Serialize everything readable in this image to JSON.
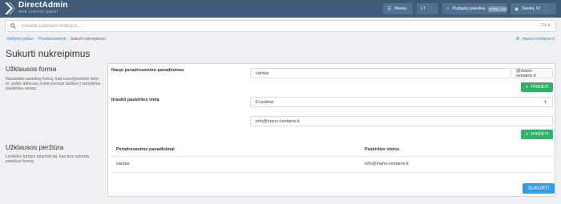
{
  "brand": {
    "title": "DirectAdmin",
    "subtitle": "web control panel"
  },
  "topbar": {
    "menu_label": "Meniu",
    "lang_label": "LT",
    "search_label": "Pudapių paieška",
    "search_kbd": "CTRL + K",
    "user_label": "Sveiki, iV"
  },
  "search": {
    "placeholder": "Įveskite paieškos kriterijus...",
    "shortcut": "Ctrl K"
  },
  "breadcrumb": {
    "items": [
      "Valdymo pultas",
      "Peradresavimai",
      "Sukurti nukreipimus"
    ]
  },
  "domain": "mano-svetaine.lt",
  "page_title": "Sukurti nukreipimus",
  "sections": {
    "request_form": {
      "title": "Užklausos forma",
      "desc": "Naudokite pateiktą formą, kad nurodytumėte kelis el. pašto adresus, kurie persiųs laiškus į nurodytas paskirties vietas."
    },
    "request_preview": {
      "title": "Užklausos peržiūra",
      "desc": "Lentelės turinys atspindi tai, kas bus sukurta pateikus formą"
    }
  },
  "form": {
    "new_label": "Naujo peradresavimo pavadinimas",
    "name_value": "vardas",
    "domain_suffix": "@mano-svetaine.lt",
    "add_label": "PRIDĖTI",
    "dest_label": "Įtraukti paskirties vietą",
    "dest_select": "El.paštas",
    "dest_value": "info@mano-svetaine.lt",
    "add_label_2": "PRIDĖTI"
  },
  "table": {
    "headers": [
      "Peradresavimo pavadinimai",
      "Paskirties vietos"
    ],
    "rows": [
      {
        "name": "vardas",
        "dest": "info@mano-svetaine.lt"
      }
    ]
  },
  "submit_label": "SUKURTI",
  "colors": {
    "topbar": "#3f5b78",
    "accent": "#3d87c4",
    "green": "#2fb36a",
    "blue": "#2f9fe5"
  }
}
